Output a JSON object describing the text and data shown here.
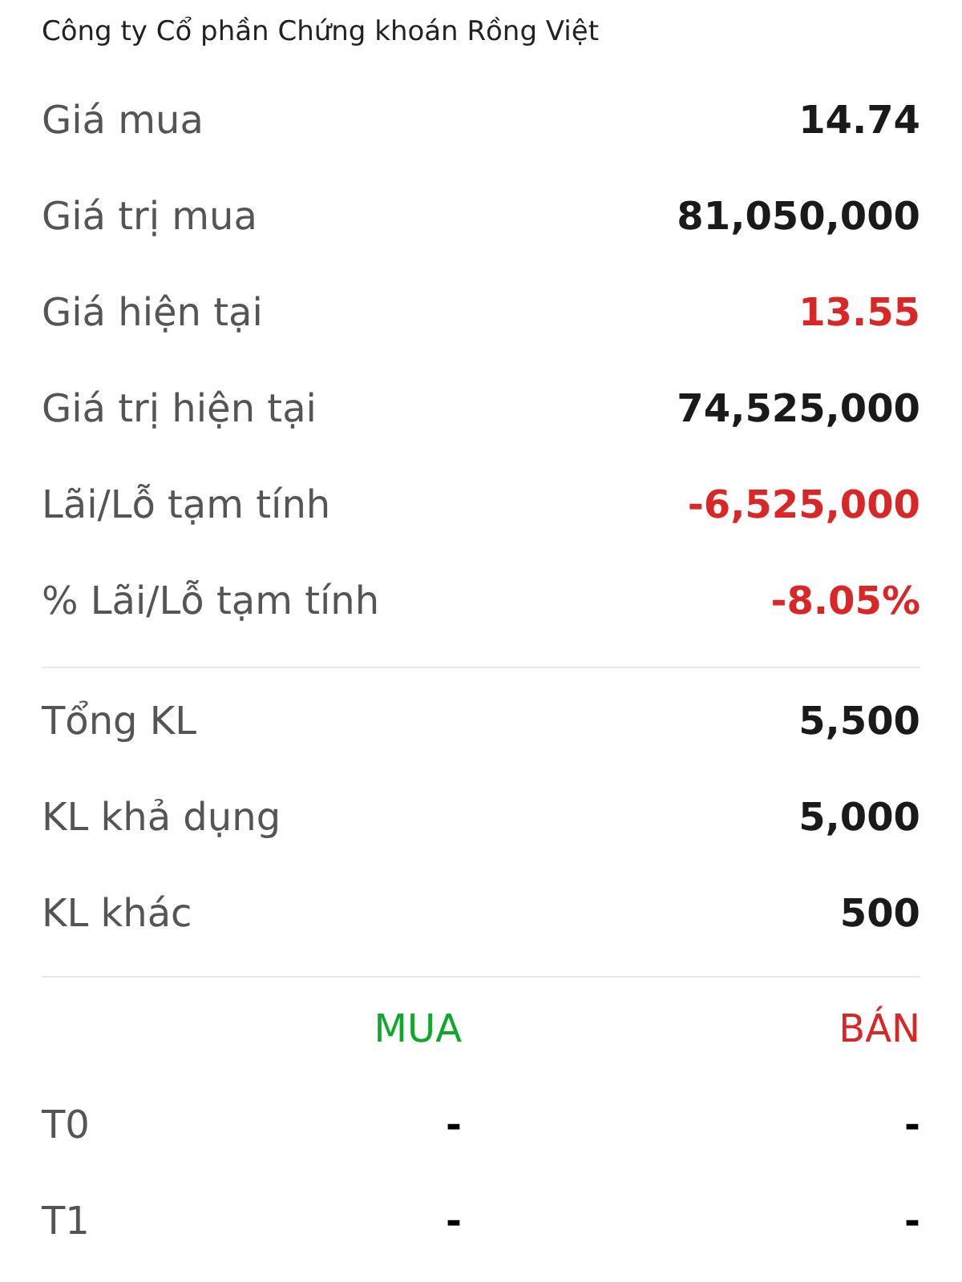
{
  "company_name": "Công ty Cổ phần Chứng khoán Rồng Việt",
  "sections": [
    {
      "rows": [
        {
          "label": "Giá mua",
          "value": "14.74",
          "color": "#1a1a1a"
        },
        {
          "label": "Giá trị mua",
          "value": "81,050,000",
          "color": "#1a1a1a"
        },
        {
          "label": "Giá hiện tại",
          "value": "13.55",
          "color": "#d92626"
        },
        {
          "label": "Giá trị hiện tại",
          "value": "74,525,000",
          "color": "#1a1a1a"
        },
        {
          "label": "Lãi/Lỗ tạm tính",
          "value": "-6,525,000",
          "color": "#d92626"
        },
        {
          "label": "% Lãi/Lỗ tạm tính",
          "value": "-8.05%",
          "color": "#d92626"
        }
      ]
    },
    {
      "rows": [
        {
          "label": "Tổng KL",
          "value": "5,500",
          "color": "#1a1a1a"
        },
        {
          "label": "KL khả dụng",
          "value": "5,000",
          "color": "#1a1a1a"
        },
        {
          "label": "KL khác",
          "value": "500",
          "color": "#1a1a1a"
        }
      ]
    }
  ],
  "settlement_table": {
    "columns": [
      {
        "label": "MUA",
        "kind": "buy"
      },
      {
        "label": "BÁN",
        "kind": "sell"
      }
    ],
    "rows": [
      {
        "label": "T0",
        "buy": "-",
        "sell": "-"
      },
      {
        "label": "T1",
        "buy": "-",
        "sell": "-"
      }
    ]
  }
}
